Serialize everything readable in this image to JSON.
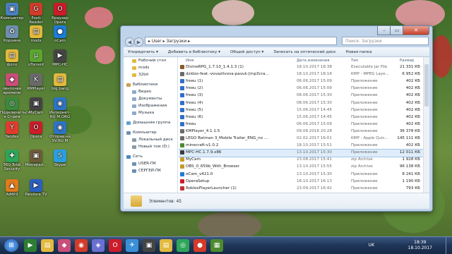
{
  "desktop": {
    "icons": [
      {
        "label": "Компьютер",
        "glyph": "▣",
        "color": "#4a7fc0"
      },
      {
        "label": "Foxit Reader",
        "glyph": "G",
        "color": "#d23b2a"
      },
      {
        "label": "Браузер Opera",
        "glyph": "O",
        "color": "#cc1c2a"
      },
      {
        "label": "Корзина",
        "glyph": "♻",
        "color": "#6f8fb0"
      },
      {
        "label": "mods",
        "glyph": "▤",
        "color": "#e3b93e"
      },
      {
        "label": "oCam",
        "glyph": "●",
        "color": "#1f7bd6"
      },
      {
        "label": "фото",
        "glyph": "▤",
        "color": "#e3b93e"
      },
      {
        "label": "uTorrent",
        "glyph": "µ",
        "color": "#5ba631"
      },
      {
        "label": "MPC-HC",
        "glyph": "▶",
        "color": "#444"
      },
      {
        "label": "ленточки времени",
        "glyph": "◆",
        "color": "#c94e7a"
      },
      {
        "label": "KMPlayer",
        "glyph": "K",
        "color": "#6a6a6a"
      },
      {
        "label": "big bang",
        "glyph": "▤",
        "color": "#e3b93e"
      },
      {
        "label": "Подключиться к Стрим",
        "glyph": "◎",
        "color": "#3b8a3b"
      },
      {
        "label": "MyCam",
        "glyph": "▣",
        "color": "#444"
      },
      {
        "label": "Интернет-RU M.ORG",
        "glyph": "◉",
        "color": "#2d74c4"
      },
      {
        "label": "Yandex",
        "glyph": "Y",
        "color": "#e03b2e"
      },
      {
        "label": "Opera",
        "glyph": "O",
        "color": "#cc1c2a"
      },
      {
        "label": "Отправ на SV.RU.M",
        "glyph": "◉",
        "color": "#2d74c4"
      },
      {
        "label": "360 Total Security",
        "glyph": "✚",
        "color": "#2ea65a"
      },
      {
        "label": "Минерал...",
        "glyph": "▣",
        "color": "#6e5b3b"
      },
      {
        "label": "Skype",
        "glyph": "S",
        "color": "#2a9fe0"
      },
      {
        "label": "AIMP3",
        "glyph": "▲",
        "color": "#e07a1f"
      },
      {
        "label": "Pandora TV",
        "glyph": "▶",
        "color": "#2b5fbf"
      }
    ]
  },
  "window": {
    "nav_back": "◀",
    "nav_forward": "▶",
    "address_path": "▸ User ▸ Загрузки ▸",
    "search_placeholder": "Поиск: Загрузки",
    "toolbar": {
      "organize": "Упорядочить ▾",
      "add_library": "Добавить в библиотеку ▾",
      "share": "Общий доступ ▾",
      "burn": "Записать на оптический диск",
      "new_folder": "Новая папка"
    },
    "nav_pane": [
      {
        "label": "Рабочий стол",
        "kind": "folder"
      },
      {
        "label": "mods",
        "kind": "folder"
      },
      {
        "label": "32bit",
        "kind": "folder"
      },
      {
        "label": "Библиотеки",
        "kind": "library"
      },
      {
        "label": "Видео",
        "kind": "lib"
      },
      {
        "label": "Документы",
        "kind": "lib"
      },
      {
        "label": "Изображения",
        "kind": "lib"
      },
      {
        "label": "Музыка",
        "kind": "lib"
      },
      {
        "label": "Домашняя группа",
        "kind": "home"
      },
      {
        "label": "Компьютер",
        "kind": "pc"
      },
      {
        "label": "Локальный диск",
        "kind": "disk"
      },
      {
        "label": "Новый том (D:)",
        "kind": "disk"
      },
      {
        "label": "Сеть",
        "kind": "net"
      },
      {
        "label": "USER-ПК",
        "kind": "pc"
      },
      {
        "label": "СЕРГЕЙ-ПК",
        "kind": "pc"
      }
    ],
    "columns": {
      "name": "Имя",
      "date": "Дата изменения",
      "type": "Тип",
      "size": "Размер"
    },
    "files": [
      {
        "name": "DivineRPG_1.7.10_1.4.1.3 (1)",
        "date": "18.10.2017 18:38",
        "type": "Executable Jar File",
        "size": "21 331 КБ",
        "icon": "#8a5a2b"
      },
      {
        "name": "dzidzo-feat.-vovazilvova-pavuk-[mp3cra...",
        "date": "18.10.2017 18:16",
        "type": "KMP - MPEG Laye...",
        "size": "6 952 КБ",
        "icon": "#6b6b6b"
      },
      {
        "name": "freeu (1)",
        "date": "06.06.2017 15:09",
        "type": "Приложение",
        "size": "402 КБ",
        "icon": "#2f6fc7"
      },
      {
        "name": "freeu (2)",
        "date": "06.06.2017 15:09",
        "type": "Приложение",
        "size": "402 КБ",
        "icon": "#2f6fc7"
      },
      {
        "name": "freeu (3)",
        "date": "08.06.2017 15:30",
        "type": "Приложение",
        "size": "402 КБ",
        "icon": "#2f6fc7"
      },
      {
        "name": "freeu (4)",
        "date": "08.06.2017 15:30",
        "type": "Приложение",
        "size": "402 КБ",
        "icon": "#2f6fc7"
      },
      {
        "name": "freeu (5)",
        "date": "15.06.2017 14:45",
        "type": "Приложение",
        "size": "402 КБ",
        "icon": "#2f6fc7"
      },
      {
        "name": "freeu (6)",
        "date": "15.06.2017 14:45",
        "type": "Приложение",
        "size": "402 КБ",
        "icon": "#2f6fc7"
      },
      {
        "name": "freeu",
        "date": "06.06.2017 15:09",
        "type": "Приложение",
        "size": "402 КБ",
        "icon": "#2f6fc7"
      },
      {
        "name": "KMPlayer_4.1.1.5",
        "date": "09.08.2016 20:28",
        "type": "Приложение",
        "size": "36 378 КБ",
        "icon": "#6b6b6b"
      },
      {
        "name": "LEGO Batman 3_Mobile Trailer_ENG_no ...",
        "date": "02.02.2017 16:01",
        "type": "KMP - Apple Quic...",
        "size": "145 111 КБ",
        "icon": "#6b6b6b"
      },
      {
        "name": "minecraft-v1.0.2",
        "date": "18.10.2017 15:51",
        "type": "Приложение",
        "size": "402 КБ",
        "icon": "#4d8a2f"
      },
      {
        "name": "MPC-HC.1.7.9.x86",
        "date": "13.10.2017 15:30",
        "type": "Приложение",
        "size": "12 011 КБ",
        "icon": "#3b3b3b"
      },
      {
        "name": "MyCam",
        "date": "23.08.2017 15:41",
        "type": "zip Archive",
        "size": "1 928 КБ",
        "icon": "#c79a2b"
      },
      {
        "name": "OBS_0_659b_With_Browser",
        "date": "13.10.2017 15:55",
        "type": "zip Archive",
        "size": "96 138 КБ",
        "icon": "#c79a2b"
      },
      {
        "name": "oCam_v421.0",
        "date": "13.10.2017 15:30",
        "type": "Приложение",
        "size": "8 241 КБ",
        "icon": "#1f7bd6"
      },
      {
        "name": "OperaSetup",
        "date": "18.10.2017 16:13",
        "type": "Приложение",
        "size": "1 190 КБ",
        "icon": "#cc1c2a"
      },
      {
        "name": "RobloxPlayerLauncher (1)",
        "date": "23.09.2017 16:42",
        "type": "Приложение",
        "size": "793 КБ",
        "icon": "#c03030"
      }
    ],
    "status": "Элементов: 45"
  },
  "taskbar": {
    "start_glyph": "⊞",
    "apps": [
      {
        "name": "player",
        "glyph": "▶",
        "color": "#2e7d32"
      },
      {
        "name": "explorer",
        "glyph": "▤",
        "color": "#e3b93e"
      },
      {
        "name": "media",
        "glyph": "◆",
        "color": "#c94e7a"
      },
      {
        "name": "chrome",
        "glyph": "◉",
        "color": "#d23b2a"
      },
      {
        "name": "app5",
        "glyph": "◈",
        "color": "#6a6fd1"
      },
      {
        "name": "opera",
        "glyph": "O",
        "color": "#cc1c2a"
      },
      {
        "name": "app7",
        "glyph": "✈",
        "color": "#3b8fd6"
      },
      {
        "name": "app8",
        "glyph": "▣",
        "color": "#444"
      },
      {
        "name": "explorer2",
        "glyph": "▤",
        "color": "#e3b93e"
      },
      {
        "name": "app10",
        "glyph": "◎",
        "color": "#2ea65a"
      },
      {
        "name": "app11",
        "glyph": "●",
        "color": "#d23b2a"
      },
      {
        "name": "app12",
        "glyph": "▦",
        "color": "#4d8a2f"
      }
    ],
    "lang": "UK",
    "time": "18:39",
    "date": "18.10.2017"
  }
}
